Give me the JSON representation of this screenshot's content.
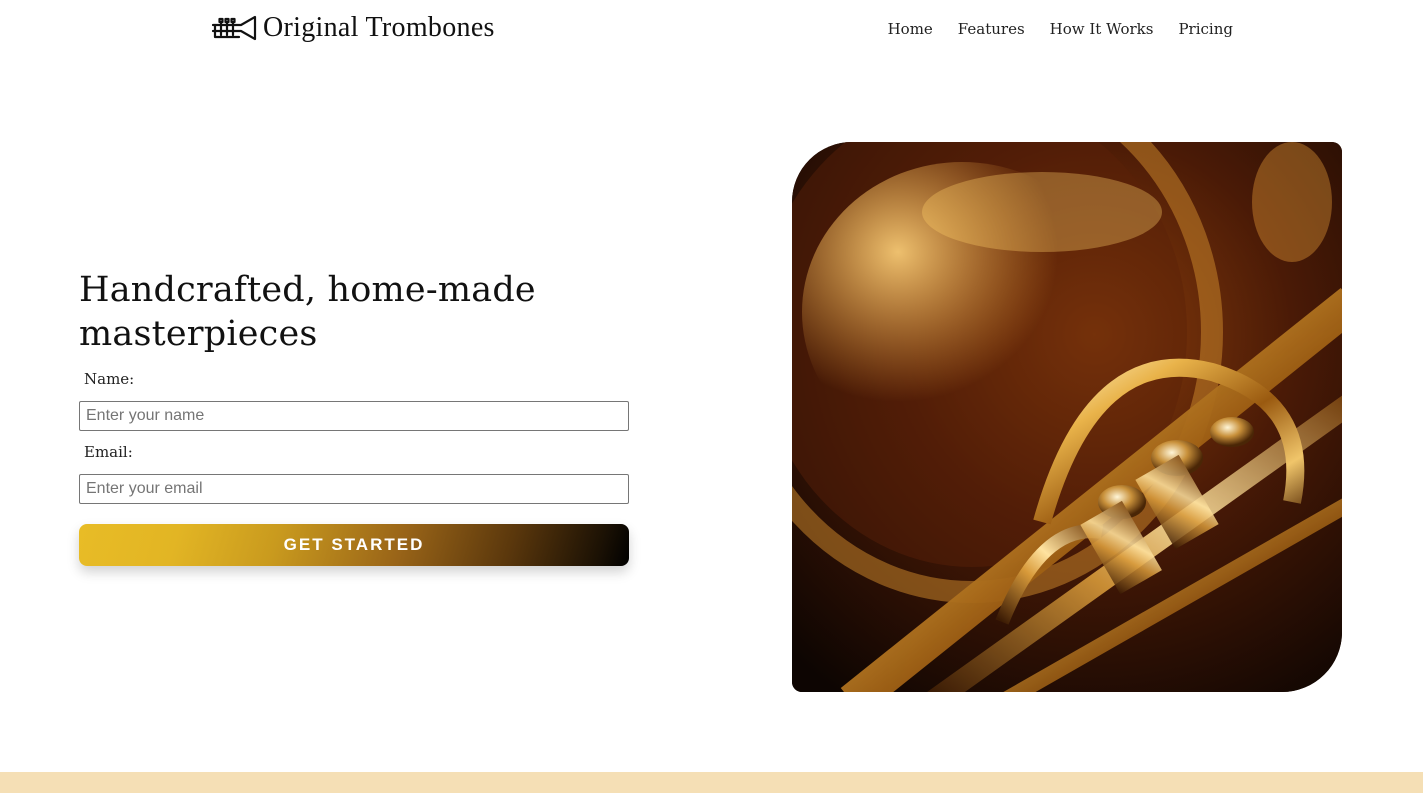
{
  "brand": {
    "name": "Original Trombones",
    "icon": "trombone-icon"
  },
  "nav": {
    "items": [
      {
        "label": "Home"
      },
      {
        "label": "Features"
      },
      {
        "label": "How It Works"
      },
      {
        "label": "Pricing"
      }
    ]
  },
  "hero": {
    "title": "Handcrafted, home-made masterpieces",
    "form": {
      "name_label": "Name:",
      "name_placeholder": "Enter your name",
      "name_value": "",
      "email_label": "Email:",
      "email_placeholder": "Enter your email",
      "email_value": "",
      "submit_label": "GET STARTED"
    },
    "image": {
      "subject": "brass-instrument-closeup"
    }
  },
  "colors": {
    "button_gradient_start": "#e8bc26",
    "button_gradient_end": "#000000",
    "footer_band": "#f5dfb5",
    "text": "#111111"
  }
}
